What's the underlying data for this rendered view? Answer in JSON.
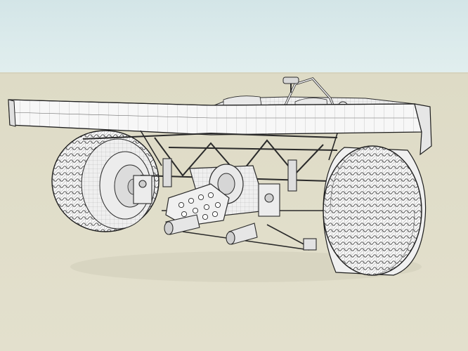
{
  "scene": {
    "subject": "wireframe-race-car-model",
    "colors": {
      "sky": "#d9e9ea",
      "ground": "#e0ddc9",
      "line": "#2a2a2a",
      "fill": "#f4f4f4",
      "shade": "#d8d8d8"
    }
  }
}
